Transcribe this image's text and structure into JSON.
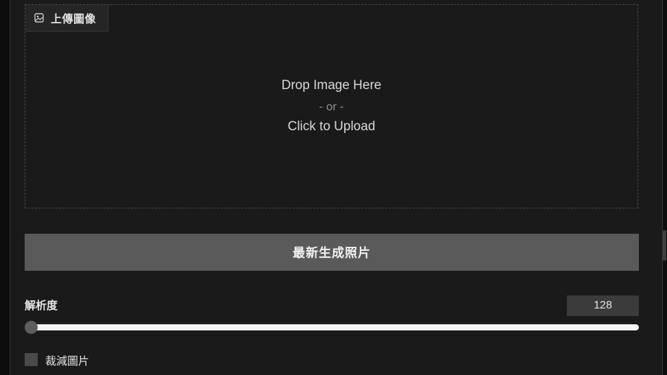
{
  "upload": {
    "label": "上傳圖像",
    "drop_text": "Drop Image Here",
    "or_text": "- or -",
    "click_text": "Click to Upload"
  },
  "generate": {
    "label": "最新生成照片"
  },
  "resolution": {
    "label": "解析度",
    "value": "128",
    "slider_fraction": 0
  },
  "crop": {
    "label": "裁減圖片",
    "checked": false
  },
  "colors": {
    "panel_bg": "#1a1a1a",
    "button_bg": "#5a5a5a",
    "slider_track": "#f4f4f4"
  }
}
